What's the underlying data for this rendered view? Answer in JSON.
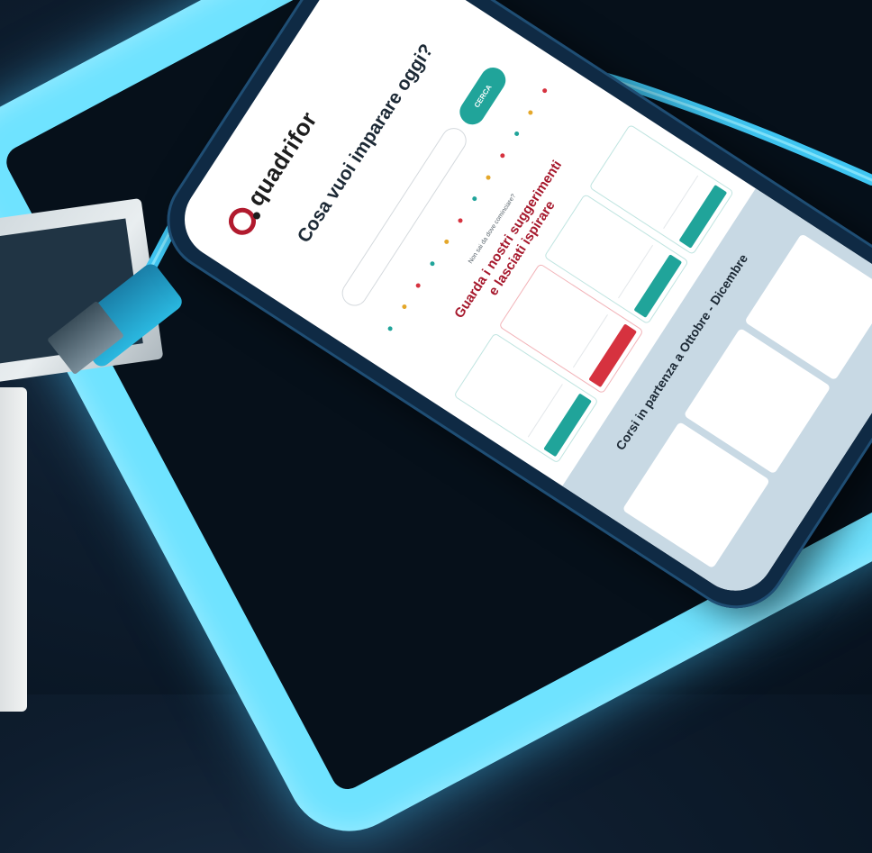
{
  "app": {
    "logo_text": "quadrifor",
    "brand_color": "#b11a2e",
    "accent_color": "#20a49a"
  },
  "hero": {
    "title": "Cosa vuoi imparare oggi?"
  },
  "search": {
    "button_label": "CERCA"
  },
  "suggestions": {
    "question": "Non sai da dove cominciare?",
    "title_line1": "Guarda i nostri suggerimenti",
    "title_line2": "e lasciati ispirare",
    "dot_colors": [
      "#20a49a",
      "#e4a72a",
      "#d6323f",
      "#20a49a",
      "#e4a72a",
      "#d6323f",
      "#20a49a",
      "#e4a72a",
      "#d6323f",
      "#20a49a",
      "#e4a72a",
      "#d6323f"
    ]
  },
  "band": {
    "title": "Corsi in partenza a Ottobre - Dicembre"
  }
}
